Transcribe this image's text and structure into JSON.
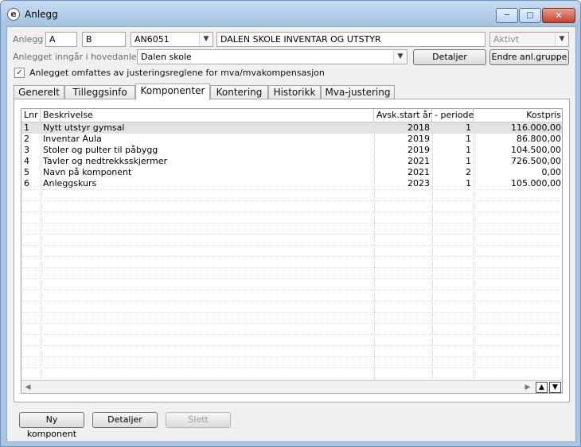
{
  "window": {
    "title": "Anlegg",
    "app_icon_glyph": "e"
  },
  "header": {
    "anlegg_label": "Anlegg",
    "field_a": "A",
    "field_b": "B",
    "code": "AN6051",
    "name": "DALEN SKOLE INVENTAR OG UTSTYR",
    "status": "Aktivt",
    "hovedanlegg_label": "Anlegget inngår i hovedanlegg",
    "hovedanlegg_value": "Dalen skole",
    "detaljer_button": "Detaljer",
    "endre_button": "Endre anl.gruppe",
    "mva_checkbox_label": "Anlegget omfattes av justeringsreglene for mva/mvakompensasjon",
    "mva_checked": true
  },
  "tabs": [
    {
      "label": "Generelt"
    },
    {
      "label": "Tilleggsinfo"
    },
    {
      "label": "Komponenter"
    },
    {
      "label": "Kontering"
    },
    {
      "label": "Historikk"
    },
    {
      "label": "Mva-justering"
    }
  ],
  "active_tab": "Komponenter",
  "grid": {
    "columns": [
      "Lnr",
      "Beskrivelse",
      "Avsk.start år",
      "- periode",
      "Kostpris"
    ],
    "rows": [
      {
        "lnr": "1",
        "beskrivelse": "Nytt utstyr gymsal",
        "aar": "2018",
        "periode": "1",
        "kostpris": "116.000,00"
      },
      {
        "lnr": "2",
        "beskrivelse": "Inventar Aula",
        "aar": "2019",
        "periode": "1",
        "kostpris": "86.800,00"
      },
      {
        "lnr": "3",
        "beskrivelse": "Stoler og pulter til påbygg",
        "aar": "2019",
        "periode": "1",
        "kostpris": "104.500,00"
      },
      {
        "lnr": "4",
        "beskrivelse": "Tavler og nedtrekksskjermer",
        "aar": "2021",
        "periode": "1",
        "kostpris": "726.500,00"
      },
      {
        "lnr": "5",
        "beskrivelse": "Navn på komponent",
        "aar": "2021",
        "periode": "2",
        "kostpris": "0,00"
      },
      {
        "lnr": "6",
        "beskrivelse": "Anleggskurs",
        "aar": "2023",
        "periode": "1",
        "kostpris": "105.000,00"
      }
    ],
    "selected_row": 0
  },
  "footer": {
    "ny_komponent": "Ny komponent",
    "detaljer": "Detaljer",
    "slett": "Slett"
  },
  "icons": {
    "combo_arrow": "chevron-down-icon",
    "check": "check-icon",
    "scroll_left": "arrow-left-icon",
    "scroll_right": "arrow-right-icon",
    "nav_up": "double-chevron-up-icon",
    "nav_down": "double-chevron-down-icon"
  }
}
